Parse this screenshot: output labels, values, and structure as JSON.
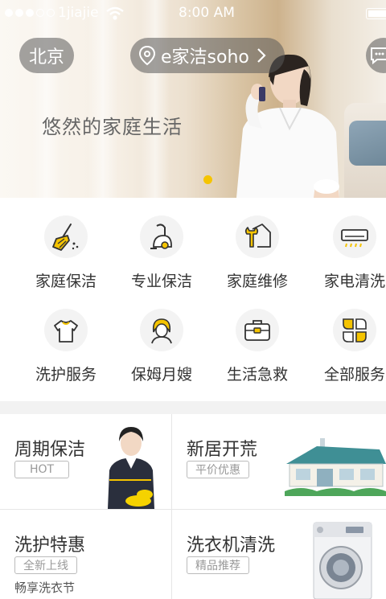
{
  "status_bar": {
    "carrier": "1jiajie",
    "time": "8:00 AM"
  },
  "header": {
    "city": "北京",
    "location": "e家洁soho"
  },
  "banner": {
    "slogan": "悠然的家庭生活"
  },
  "services": [
    {
      "label": "家庭保洁",
      "icon": "broom-icon"
    },
    {
      "label": "专业保洁",
      "icon": "vacuum-icon"
    },
    {
      "label": "家庭维修",
      "icon": "wrench-house-icon"
    },
    {
      "label": "家电清洗",
      "icon": "air-conditioner-icon"
    },
    {
      "label": "洗护服务",
      "icon": "shirt-icon"
    },
    {
      "label": "保姆月嫂",
      "icon": "nanny-icon"
    },
    {
      "label": "生活急救",
      "icon": "toolbox-icon"
    },
    {
      "label": "全部服务",
      "icon": "all-services-icon"
    }
  ],
  "promos": {
    "periodic": {
      "title": "周期保洁",
      "tag": "HOT"
    },
    "new_home": {
      "title": "新居开荒",
      "tag": "平价优惠"
    },
    "laundry": {
      "title": "洗护特惠",
      "tag": "全新上线",
      "subtitle": "畅享洗衣节"
    },
    "washer": {
      "title": "洗衣机清洗",
      "tag": "精品推荐"
    }
  },
  "colors": {
    "accent": "#f5c400"
  }
}
